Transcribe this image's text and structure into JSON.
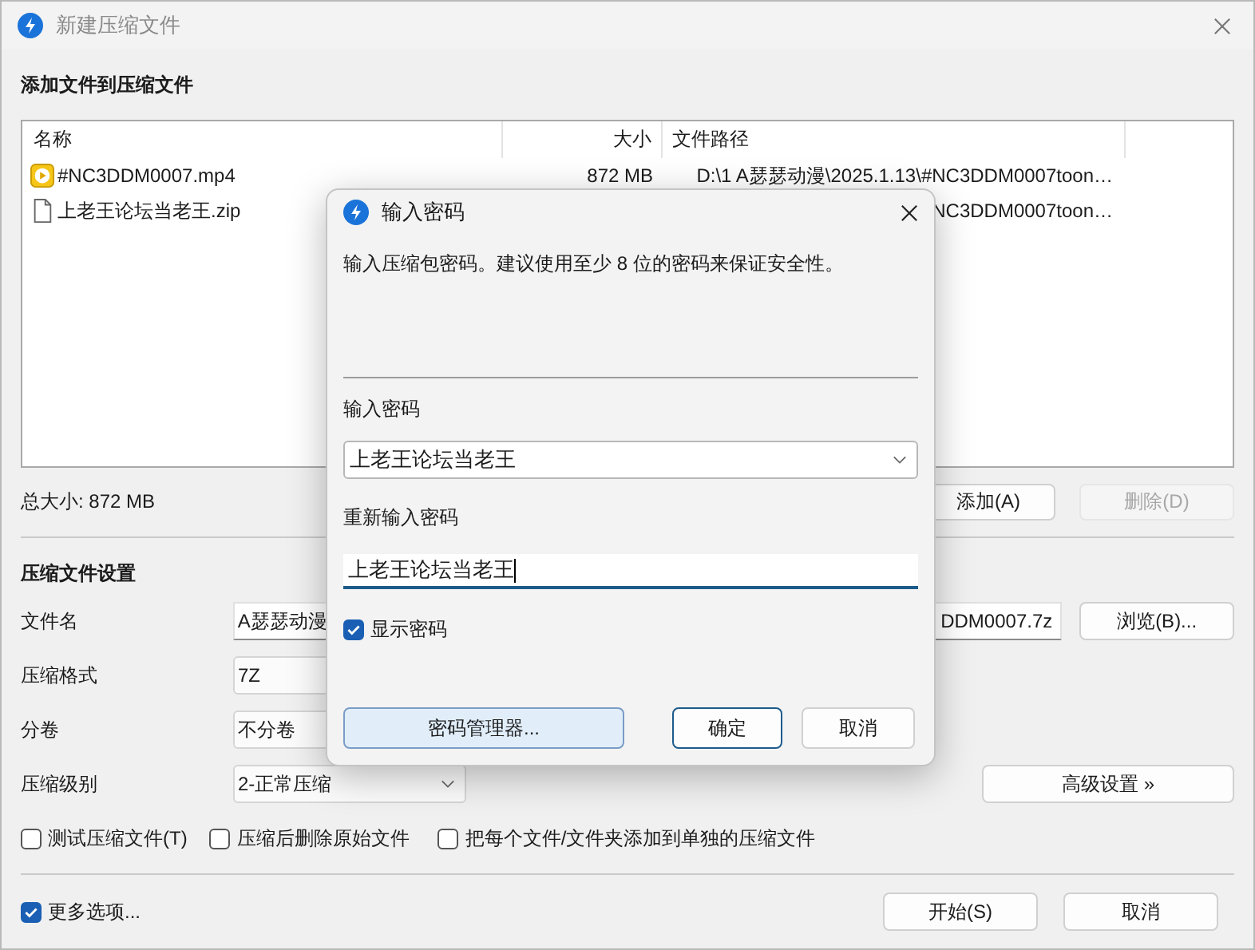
{
  "window": {
    "title": "新建压缩文件"
  },
  "files_section": {
    "heading": "添加文件到压缩文件",
    "columns": [
      "名称",
      "大小",
      "文件路径"
    ],
    "rows": [
      {
        "kind": "video",
        "name": "#NC3DDM0007.mp4",
        "size": "872 MB",
        "path": "D:\\1 A瑟瑟动漫\\2025.1.13\\#NC3DDM0007toon…"
      },
      {
        "kind": "document",
        "name": "上老王论坛当老王.zip",
        "path": "NC3DDM0007toon…"
      }
    ],
    "total": "总大小: 872 MB",
    "buttons": [
      {
        "label": "添加(A)",
        "disabled": false
      },
      {
        "label": "删除(D)",
        "disabled": true
      }
    ]
  },
  "settings": {
    "heading": "压缩文件设置",
    "rows": [
      {
        "kind": "text",
        "label": "文件名",
        "value_start": "A瑟瑟动漫",
        "value_end": "DDM0007.7z",
        "button": "浏览(B)..."
      },
      {
        "kind": "combo",
        "label": "压缩格式",
        "value": "7Z"
      },
      {
        "kind": "combo",
        "label": "分卷",
        "value": "不分卷"
      },
      {
        "kind": "combo",
        "label": "压缩级别",
        "value": "2-正常压缩",
        "button": "高级设置 »"
      }
    ],
    "options": [
      {
        "label": "测试压缩文件(T)",
        "checked": false
      },
      {
        "label": "压缩后删除原始文件",
        "checked": false
      },
      {
        "label": "把每个文件/文件夹添加到单独的压缩文件",
        "checked": false
      }
    ]
  },
  "footer": {
    "more_options": {
      "label": "更多选项...",
      "checked": true
    },
    "buttons": [
      "开始(S)",
      "取消"
    ]
  },
  "dialog": {
    "title": "输入密码",
    "description": "输入压缩包密码。建议使用至少 8 位的密码来保证安全性。",
    "password_label": "输入密码",
    "password_value": "上老王论坛当老王",
    "confirm_label": "重新输入密码",
    "confirm_value": "上老王论坛当老王",
    "confirm_focused": true,
    "show_password": {
      "label": "显示密码",
      "checked": true
    },
    "buttons": [
      {
        "kind": "manager",
        "label": "密码管理器..."
      },
      {
        "kind": "default",
        "label": "确定"
      },
      {
        "kind": "normal",
        "label": "取消"
      }
    ]
  }
}
